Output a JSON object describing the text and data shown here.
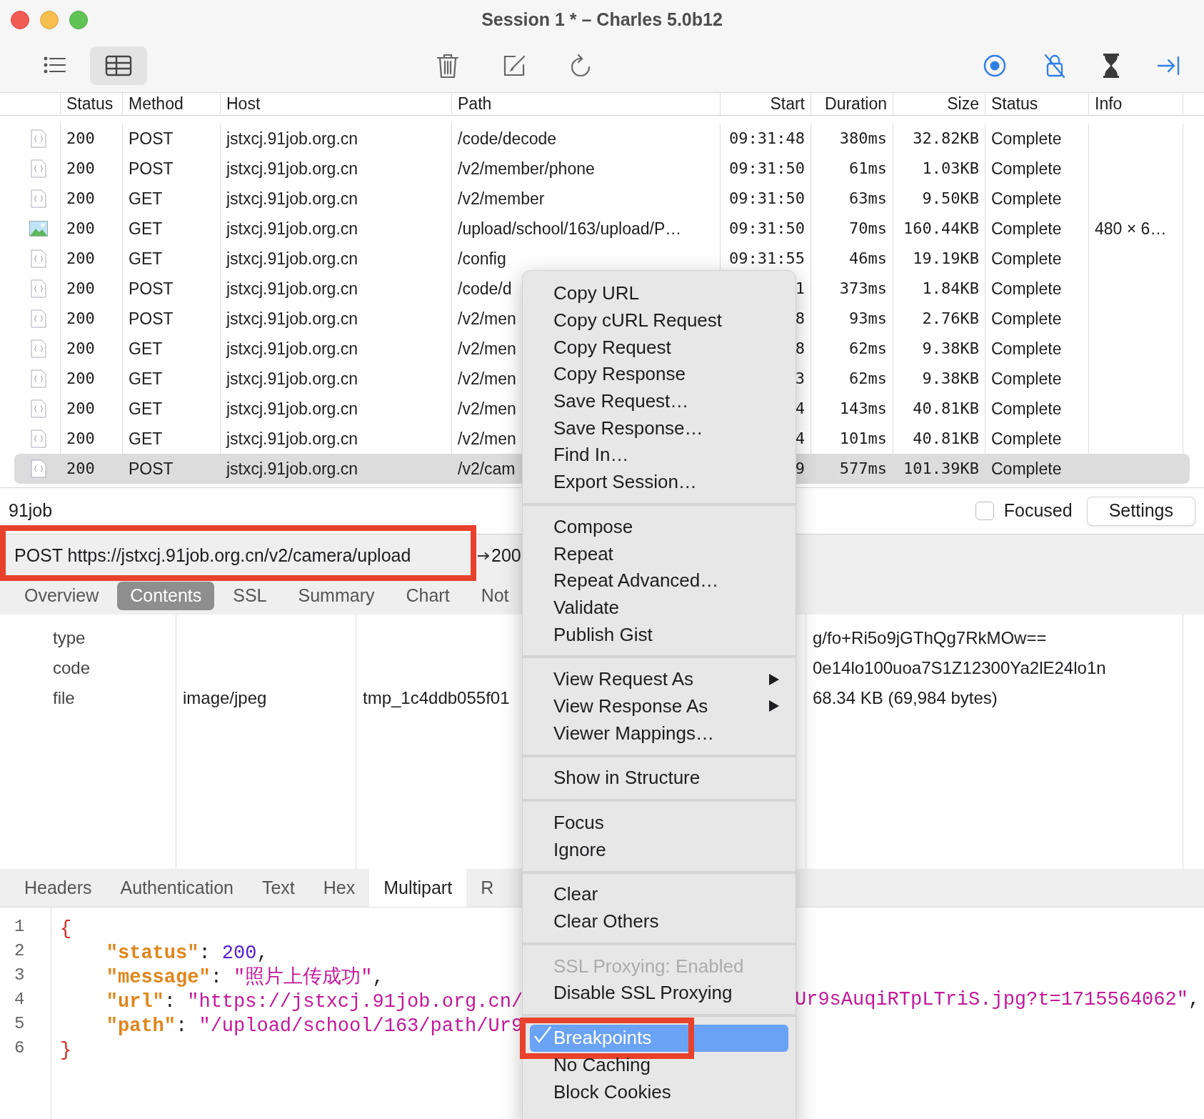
{
  "window": {
    "title": "Session 1 * – Charles 5.0b12"
  },
  "view_modes": [
    {
      "selected": false
    },
    {
      "selected": true
    }
  ],
  "toolbar_toggles": [
    {
      "on": true
    },
    {
      "on": true
    },
    {
      "on": false
    },
    {
      "on": true
    }
  ],
  "table": {
    "columns": [
      "Status",
      "Method",
      "Host",
      "Path",
      "Start",
      "Duration",
      "Size",
      "Status",
      "Info"
    ],
    "rows": [
      {
        "kind": "document",
        "selected": false,
        "cells": [
          "200",
          "POST",
          "jstxcj.91job.org.cn",
          "/code/decode",
          "09:31:48",
          "380ms",
          "32.82KB",
          "Complete",
          ""
        ]
      },
      {
        "kind": "document",
        "selected": false,
        "cells": [
          "200",
          "POST",
          "jstxcj.91job.org.cn",
          "/v2/member/phone",
          "09:31:50",
          "61ms",
          "1.03KB",
          "Complete",
          ""
        ]
      },
      {
        "kind": "document",
        "selected": false,
        "cells": [
          "200",
          "GET",
          "jstxcj.91job.org.cn",
          "/v2/member",
          "09:31:50",
          "63ms",
          "9.50KB",
          "Complete",
          ""
        ]
      },
      {
        "kind": "image",
        "selected": false,
        "cells": [
          "200",
          "GET",
          "jstxcj.91job.org.cn",
          "/upload/school/163/upload/P…",
          "09:31:50",
          "70ms",
          "160.44KB",
          "Complete",
          "480 × 6…"
        ]
      },
      {
        "kind": "document",
        "selected": false,
        "cells": [
          "200",
          "GET",
          "jstxcj.91job.org.cn",
          "/config",
          "09:31:55",
          "46ms",
          "19.19KB",
          "Complete",
          ""
        ]
      },
      {
        "kind": "document",
        "selected": false,
        "cells": [
          "200",
          "POST",
          "jstxcj.91job.org.cn",
          "/code/d",
          "1",
          "373ms",
          "1.84KB",
          "Complete",
          ""
        ]
      },
      {
        "kind": "document",
        "selected": false,
        "cells": [
          "200",
          "POST",
          "jstxcj.91job.org.cn",
          "/v2/men",
          "8",
          "93ms",
          "2.76KB",
          "Complete",
          ""
        ]
      },
      {
        "kind": "document",
        "selected": false,
        "cells": [
          "200",
          "GET",
          "jstxcj.91job.org.cn",
          "/v2/men",
          "8",
          "62ms",
          "9.38KB",
          "Complete",
          ""
        ]
      },
      {
        "kind": "document",
        "selected": false,
        "cells": [
          "200",
          "GET",
          "jstxcj.91job.org.cn",
          "/v2/men",
          "3",
          "62ms",
          "9.38KB",
          "Complete",
          ""
        ]
      },
      {
        "kind": "document",
        "selected": false,
        "cells": [
          "200",
          "GET",
          "jstxcj.91job.org.cn",
          "/v2/men",
          "4",
          "143ms",
          "40.81KB",
          "Complete",
          ""
        ]
      },
      {
        "kind": "document",
        "selected": false,
        "cells": [
          "200",
          "GET",
          "jstxcj.91job.org.cn",
          "/v2/men",
          "4",
          "101ms",
          "40.81KB",
          "Complete",
          ""
        ]
      },
      {
        "kind": "document",
        "selected": true,
        "cells": [
          "200",
          "POST",
          "jstxcj.91job.org.cn",
          "/v2/cam",
          "9",
          "577ms",
          "101.39KB",
          "Complete",
          ""
        ]
      }
    ]
  },
  "filter_bar": {
    "host": "91job",
    "focused": {
      "label": "Focused",
      "checked": false
    },
    "settings": "Settings"
  },
  "request_line": {
    "text": "POST https://jstxcj.91job.org.cn/v2/camera/upload",
    "response": "200"
  },
  "tabs": [
    {
      "label": "Overview",
      "selected": false
    },
    {
      "label": "Contents",
      "selected": true
    },
    {
      "label": "SSL",
      "selected": false
    },
    {
      "label": "Summary",
      "selected": false
    },
    {
      "label": "Chart",
      "selected": false
    },
    {
      "label": "Not",
      "selected": false
    }
  ],
  "multipart": {
    "rows": [
      {
        "name": "type",
        "content_type": "",
        "filename": "",
        "value": "g/fo+Ri5o9jGThQg7RkMOw=="
      },
      {
        "name": "code",
        "content_type": "",
        "filename": "",
        "value": "0e14lo100uoa7S1Z12300Ya2lE24lo1n"
      },
      {
        "name": "file",
        "content_type": "image/jpeg",
        "filename": "tmp_1c4ddb055f01",
        "value": "68.34 KB (69,984 bytes)"
      }
    ]
  },
  "body_tabs": [
    {
      "label": "Headers",
      "selected": false
    },
    {
      "label": "Authentication",
      "selected": false
    },
    {
      "label": "Text",
      "selected": false
    },
    {
      "label": "Hex",
      "selected": false
    },
    {
      "label": "Multipart",
      "selected": true
    },
    {
      "label": "R",
      "selected": false
    }
  ],
  "code": {
    "lines": [
      {
        "number": "1",
        "tokens": [
          {
            "kind": "brace",
            "text": "{"
          }
        ]
      },
      {
        "number": "2",
        "tokens": [
          {
            "kind": "key",
            "text": "    \"status\""
          },
          {
            "kind": "punct",
            "text": ": "
          },
          {
            "kind": "number",
            "text": "200"
          },
          {
            "kind": "punct",
            "text": ","
          }
        ]
      },
      {
        "number": "3",
        "tokens": [
          {
            "kind": "key",
            "text": "    \"message\""
          },
          {
            "kind": "punct",
            "text": ": "
          },
          {
            "kind": "string",
            "text": "\"照片上传成功\""
          },
          {
            "kind": "punct",
            "text": ","
          }
        ]
      },
      {
        "number": "4",
        "tokens": [
          {
            "kind": "key",
            "text": "    \"url\""
          },
          {
            "kind": "punct",
            "text": ": "
          },
          {
            "kind": "string",
            "text": "\"https://jstxcj.91job.org.cn/"
          }
        ],
        "tail": [
          {
            "kind": "string",
            "text": "Ur9sAuqiRTpLTriS.jpg?t=1715564062\""
          },
          {
            "kind": "punct",
            "text": ","
          }
        ]
      },
      {
        "number": "5",
        "tokens": [
          {
            "kind": "key",
            "text": "    \"path\""
          },
          {
            "kind": "punct",
            "text": ": "
          },
          {
            "kind": "string",
            "text": "\"/upload/school/163/path/Ur9"
          }
        ]
      },
      {
        "number": "6",
        "tokens": [
          {
            "kind": "brace",
            "text": "}"
          }
        ]
      }
    ]
  },
  "context_menu": {
    "items": [
      {
        "kind": "item",
        "label": "Copy URL"
      },
      {
        "kind": "item",
        "label": "Copy cURL Request"
      },
      {
        "kind": "item",
        "label": "Copy Request"
      },
      {
        "kind": "item",
        "label": "Copy Response"
      },
      {
        "kind": "item",
        "label": "Save Request…"
      },
      {
        "kind": "item",
        "label": "Save Response…"
      },
      {
        "kind": "item",
        "label": "Find In…"
      },
      {
        "kind": "item",
        "label": "Export Session…"
      },
      {
        "kind": "separator"
      },
      {
        "kind": "item",
        "label": "Compose"
      },
      {
        "kind": "item",
        "label": "Repeat"
      },
      {
        "kind": "item",
        "label": "Repeat Advanced…"
      },
      {
        "kind": "item",
        "label": "Validate"
      },
      {
        "kind": "item",
        "label": "Publish Gist"
      },
      {
        "kind": "separator"
      },
      {
        "kind": "item",
        "label": "View Request As",
        "submenu": true
      },
      {
        "kind": "item",
        "label": "View Response As",
        "submenu": true
      },
      {
        "kind": "item",
        "label": "Viewer Mappings…"
      },
      {
        "kind": "separator"
      },
      {
        "kind": "item",
        "label": "Show in Structure"
      },
      {
        "kind": "separator"
      },
      {
        "kind": "item",
        "label": "Focus"
      },
      {
        "kind": "item",
        "label": "Ignore"
      },
      {
        "kind": "separator"
      },
      {
        "kind": "item",
        "label": "Clear"
      },
      {
        "kind": "item",
        "label": "Clear Others"
      },
      {
        "kind": "separator"
      },
      {
        "kind": "item",
        "label": "SSL Proxying: Enabled",
        "disabled": true
      },
      {
        "kind": "item",
        "label": "Disable SSL Proxying"
      },
      {
        "kind": "separator"
      },
      {
        "kind": "item",
        "label": "Breakpoints",
        "checked": true,
        "highlighted": true
      },
      {
        "kind": "item",
        "label": "No Caching"
      },
      {
        "kind": "item",
        "label": "Block Cookies"
      }
    ]
  }
}
